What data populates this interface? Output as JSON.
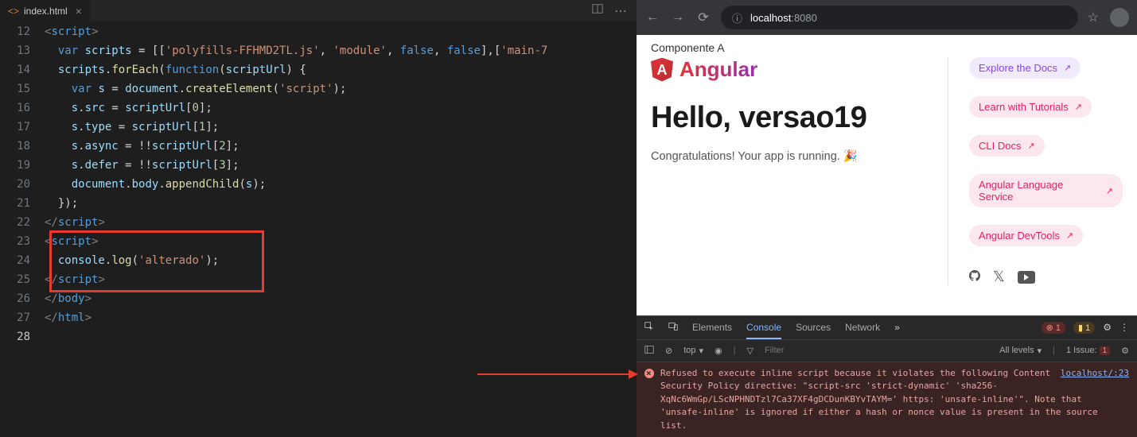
{
  "editor": {
    "tab_filename": "index.html",
    "lines": {
      "start": 12,
      "end": 28,
      "active": 28
    },
    "code_html": [
      "<span class='tok-punc'>&lt;</span><span class='tok-tag'>script</span><span class='tok-punc'>&gt;</span>",
      "  <span class='tok-kw'>var</span> <span class='tok-var'>scripts</span> = [[<span class='tok-str'>'polyfills-FFHMD2TL.js'</span>, <span class='tok-str'>'module'</span>, <span class='tok-lit'>false</span>, <span class='tok-lit'>false</span>],[<span class='tok-str'>'main-7</span>",
      "  <span class='tok-var'>scripts</span>.<span class='tok-fn'>forEach</span>(<span class='tok-kw'>function</span>(<span class='tok-var'>scriptUrl</span>) {",
      "    <span class='tok-kw'>var</span> <span class='tok-var'>s</span> = <span class='tok-var'>document</span>.<span class='tok-fn'>createElement</span>(<span class='tok-str'>'script'</span>);",
      "    <span class='tok-var'>s</span>.<span class='tok-var'>src</span> = <span class='tok-var'>scriptUrl</span>[<span class='tok-num'>0</span>];",
      "    <span class='tok-var'>s</span>.<span class='tok-var'>type</span> = <span class='tok-var'>scriptUrl</span>[<span class='tok-num'>1</span>];",
      "    <span class='tok-var'>s</span>.<span class='tok-var'>async</span> = !!<span class='tok-var'>scriptUrl</span>[<span class='tok-num'>2</span>];",
      "    <span class='tok-var'>s</span>.<span class='tok-var'>defer</span> = !!<span class='tok-var'>scriptUrl</span>[<span class='tok-num'>3</span>];",
      "    <span class='tok-var'>document</span>.<span class='tok-var'>body</span>.<span class='tok-fn'>appendChild</span>(<span class='tok-var'>s</span>);",
      "  });",
      "<span class='tok-punc'>&lt;/</span><span class='tok-tag'>script</span><span class='tok-punc'>&gt;</span>",
      "<span class='tok-punc'>&lt;</span><span class='tok-tag'>script</span><span class='tok-punc'>&gt;</span>",
      "  <span class='tok-var'>console</span>.<span class='tok-fn'>log</span>(<span class='tok-str'>'alterado'</span>);",
      "<span class='tok-punc'>&lt;/</span><span class='tok-tag'>script</span><span class='tok-punc'>&gt;</span>",
      "<span class='tok-punc'>&lt;/</span><span class='tok-tag'>body</span><span class='tok-punc'>&gt;</span>",
      "<span class='tok-punc'>&lt;/</span><span class='tok-tag'>html</span><span class='tok-punc'>&gt;</span>",
      ""
    ]
  },
  "browser": {
    "url_host": "localhost",
    "url_port": ":8080",
    "page": {
      "componente": "Componente A",
      "brand": "Angular",
      "heading": "Hello, versao19",
      "congrats": "Congratulations! Your app is running. 🎉",
      "links": [
        "Explore the Docs",
        "Learn with Tutorials",
        "CLI Docs",
        "Angular Language Service",
        "Angular DevTools"
      ]
    }
  },
  "devtools": {
    "tabs": [
      "Elements",
      "Console",
      "Sources",
      "Network"
    ],
    "active_tab": "Console",
    "errors": "1",
    "warnings": "1",
    "top_label": "top",
    "filter_placeholder": "Filter",
    "levels_label": "All levels",
    "issue_label": "1 Issue:",
    "issue_count": "1",
    "error_message": "Refused to execute inline script because it violates the following Content Security Policy directive: \"script-src 'strict-dynamic' 'sha256-XqNc6WmGp/LScNPHNDTzl7Ca37XF4gDCDunKBYvTAYM=' https: 'unsafe-inline'\". Note that 'unsafe-inline' is ignored if either a hash or nonce value is present in the source list.",
    "error_link": "localhost/:23"
  }
}
